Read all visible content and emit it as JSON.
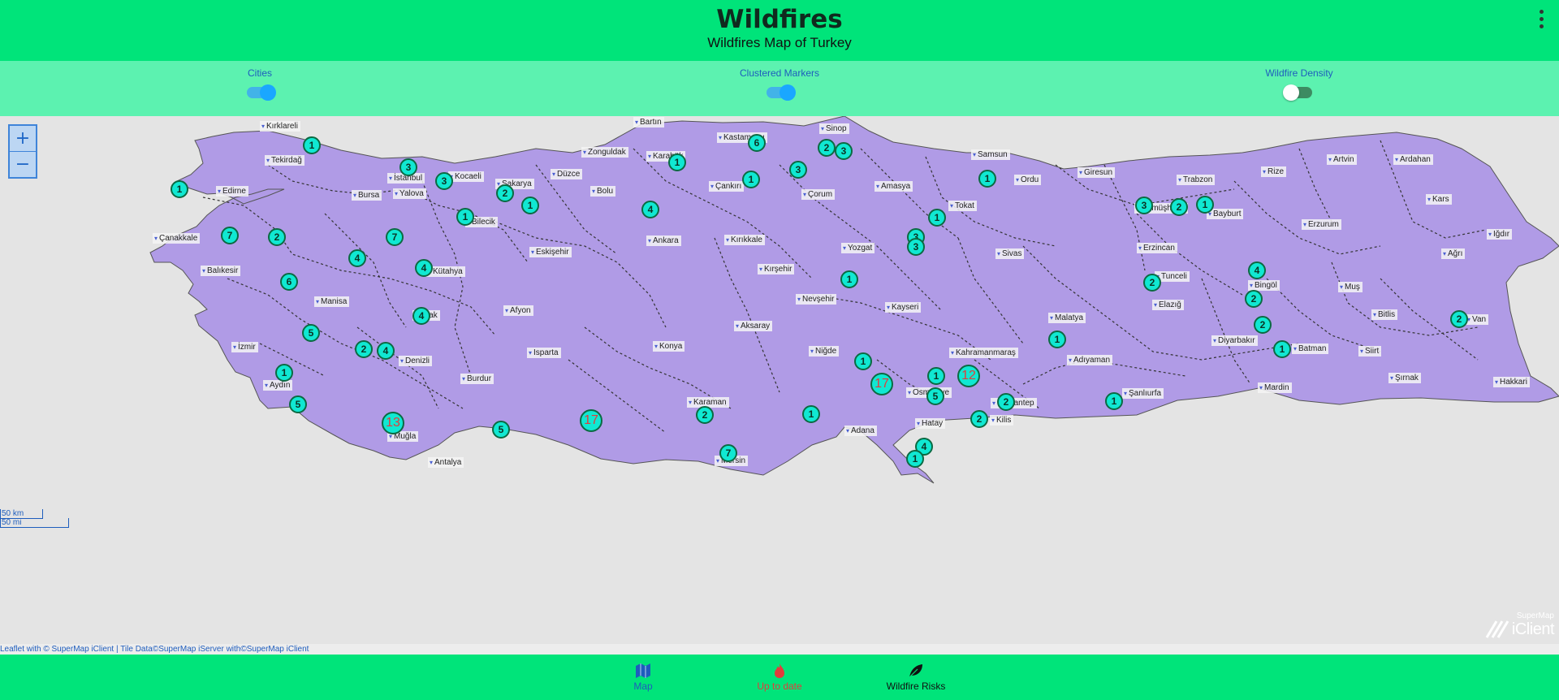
{
  "header": {
    "title": "Wildfires",
    "subtitle": "Wildfires Map of Turkey"
  },
  "controls": {
    "cities": {
      "label": "Cities",
      "on": true
    },
    "clustered": {
      "label": "Clustered Markers",
      "on": true
    },
    "density": {
      "label": "Wildfire Density",
      "on": false
    }
  },
  "map": {
    "zoom_in": "+",
    "zoom_out": "−",
    "land_color": "#b09be6",
    "cities": [
      "Kırklareli",
      "Tekirdağ",
      "Edirne",
      "İstanbul",
      "Kocaeli",
      "Bursa",
      "Yalova",
      "Sakarya",
      "Düzce",
      "Bolu",
      "Zonguldak",
      "Bartın",
      "Karabük",
      "Kastamonu",
      "Sinop",
      "Samsun",
      "Çankırı",
      "Çorum",
      "Amasya",
      "Tokat",
      "Ordu",
      "Giresun",
      "Trabzon",
      "Rize",
      "Artvin",
      "Ardahan",
      "Kars",
      "Iğdır",
      "Gümüşhane",
      "Bayburt",
      "Erzurum",
      "Erzincan",
      "Ağrı",
      "Çanakkale",
      "Balıkesir",
      "Bilecik",
      "Eskişehir",
      "Ankara",
      "Kırıkkale",
      "Yozgat",
      "Sivas",
      "Kütahya",
      "Kırşehir",
      "Manisa",
      "Uşak",
      "Afyon",
      "Nevşehir",
      "Kayseri",
      "Tunceli",
      "Bingöl",
      "Muş",
      "Elazığ",
      "Malatya",
      "Bitlis",
      "Van",
      "İzmir",
      "Aksaray",
      "Niğde",
      "Isparta",
      "Konya",
      "Kahramanmaraş",
      "Adıyaman",
      "Diyarbakır",
      "Batman",
      "Siirt",
      "Denizli",
      "Aydın",
      "Burdur",
      "Şırnak",
      "Hakkari",
      "Şanlıurfa",
      "Mardin",
      "Osmaniye",
      "Gaziantep",
      "Karaman",
      "Hatay",
      "Kilis",
      "Adana",
      "Muğla",
      "Antalya",
      "Mersin"
    ],
    "clusters": [
      1,
      1,
      3,
      3,
      2,
      1,
      4,
      1,
      6,
      1,
      2,
      3,
      3,
      1,
      1,
      1,
      2,
      1,
      3,
      2,
      3,
      7,
      1,
      4,
      4,
      4,
      6,
      2,
      7,
      5,
      2,
      4,
      1,
      5,
      13,
      5,
      17,
      2,
      7,
      1,
      1,
      17,
      12,
      5,
      2,
      2,
      4,
      1,
      1,
      1,
      4,
      2,
      1,
      2,
      2,
      1,
      3
    ],
    "scale_km": "50 km",
    "scale_mi": "50 mi",
    "attribution": "Leaflet with © SuperMap iClient | Tile Data©SuperMap iServer with©SuperMap iClient",
    "brand_small": "SuperMap",
    "brand_big": "iClient"
  },
  "nav": [
    {
      "label": "Map",
      "icon": "map-icon",
      "color": "#1e5dbd"
    },
    {
      "label": "Up to date",
      "icon": "flame-icon",
      "color": "#e23c3c"
    },
    {
      "label": "Wildfire Risks",
      "icon": "leaf-icon",
      "color": "#111111"
    }
  ]
}
